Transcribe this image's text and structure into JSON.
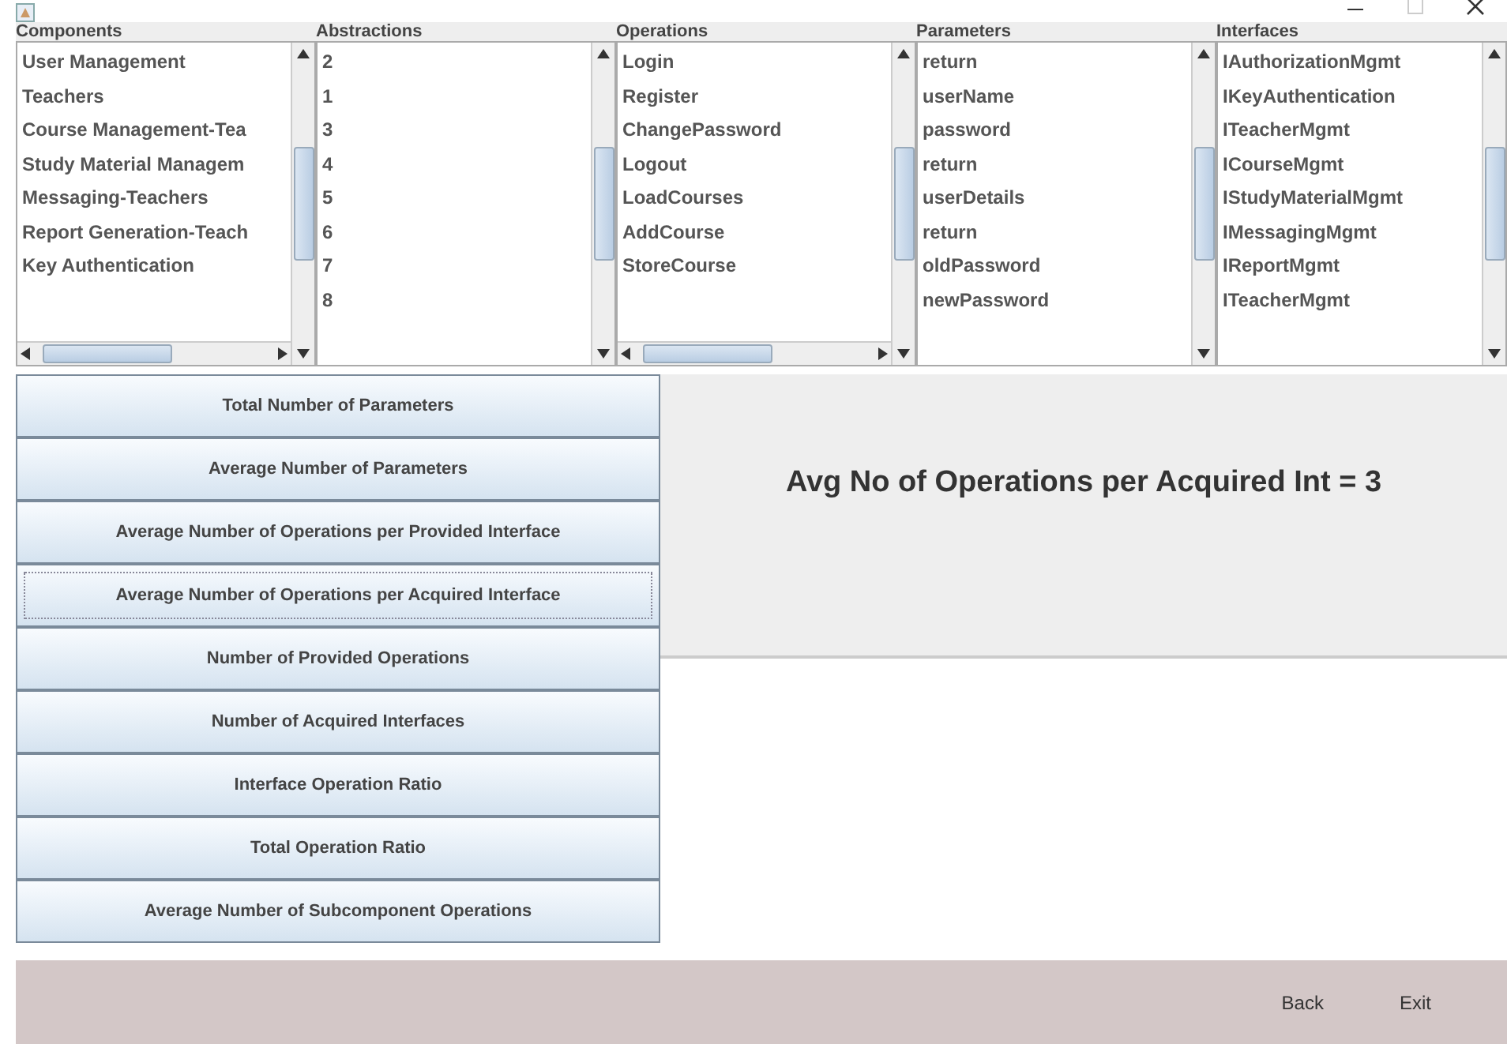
{
  "lists": [
    {
      "header": "Components",
      "horizontal_scrollbar": true,
      "items": [
        "User Management",
        "Teachers",
        "Course Management-Tea",
        "Study Material Managem",
        "Messaging-Teachers",
        "Report Generation-Teach",
        "Key Authentication"
      ]
    },
    {
      "header": "Abstractions",
      "horizontal_scrollbar": false,
      "items": [
        "2",
        "1",
        "3",
        "4",
        "5",
        "6",
        "7",
        "8"
      ]
    },
    {
      "header": "Operations",
      "horizontal_scrollbar": true,
      "items": [
        "Login",
        "Register",
        "ChangePassword",
        "Logout",
        "LoadCourses",
        "AddCourse",
        "StoreCourse"
      ]
    },
    {
      "header": "Parameters",
      "horizontal_scrollbar": false,
      "items": [
        "return",
        "userName",
        "password",
        "return",
        "userDetails",
        "return",
        "oldPassword",
        "newPassword"
      ]
    },
    {
      "header": "Interfaces",
      "horizontal_scrollbar": false,
      "items": [
        "IAuthorizationMgmt",
        "IKeyAuthentication",
        "ITeacherMgmt",
        "ICourseMgmt",
        "IStudyMaterialMgmt",
        "IMessagingMgmt",
        "IReportMgmt",
        "ITeacherMgmt"
      ]
    }
  ],
  "metric_buttons": [
    {
      "label": "Total Number of Parameters",
      "focused": false
    },
    {
      "label": "Average Number of Parameters",
      "focused": false
    },
    {
      "label": "Average Number of Operations per Provided Interface",
      "focused": false
    },
    {
      "label": "Average Number of Operations per Acquired Interface",
      "focused": true
    },
    {
      "label": "Number of Provided Operations",
      "focused": false
    },
    {
      "label": "Number of Acquired Interfaces",
      "focused": false
    },
    {
      "label": "Interface Operation Ratio",
      "focused": false
    },
    {
      "label": "Total Operation Ratio",
      "focused": false
    },
    {
      "label": "Average Number of Subcomponent Operations",
      "focused": false
    }
  ],
  "result": "Avg No of Operations per Acquired Int = 3",
  "footer_buttons": [
    "Back",
    "Exit"
  ]
}
